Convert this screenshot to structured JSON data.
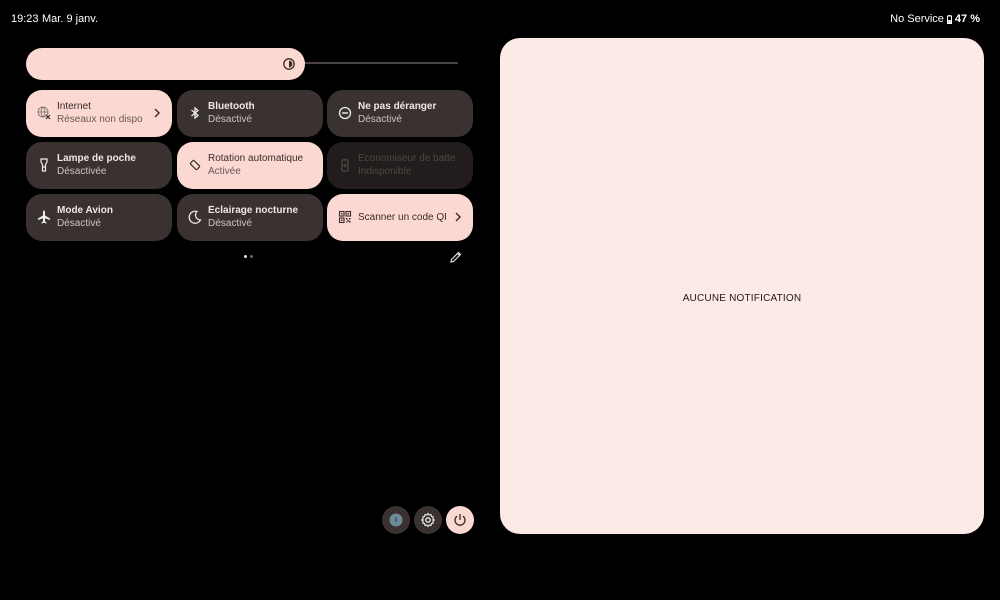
{
  "status_bar": {
    "time": "19:23",
    "date": "Mar. 9 janv.",
    "network": "No Service",
    "battery": "47 %"
  },
  "brightness": {
    "level": 0.63,
    "icon": "brightness-icon"
  },
  "tiles": [
    {
      "title": "Internet",
      "subtitle": "Réseaux non disponibles",
      "state": "active",
      "icon": "internet-off-icon"
    },
    {
      "title": "Bluetooth",
      "subtitle": "Désactivé",
      "state": "off",
      "icon": "bluetooth-icon"
    },
    {
      "title": "Ne pas déranger",
      "subtitle": "Désactivé",
      "state": "off",
      "icon": "do-not-disturb-icon"
    },
    {
      "title": "Lampe de poche",
      "subtitle": "Désactivée",
      "state": "off",
      "icon": "flashlight-icon"
    },
    {
      "title": "Rotation automatique",
      "subtitle": "Activée",
      "state": "active",
      "icon": "rotation-icon"
    },
    {
      "title": "Économiseur de batterie",
      "subtitle": "Indisponible",
      "state": "unavailable",
      "icon": "battery-saver-icon"
    },
    {
      "title": "Mode Avion",
      "subtitle": "Désactivé",
      "state": "off",
      "icon": "airplane-icon"
    },
    {
      "title": "Éclairage nocturne",
      "subtitle": "Désactivé",
      "state": "off",
      "icon": "night-light-icon"
    },
    {
      "title": "Scanner un code QR",
      "state": "active",
      "icon": "qr-code-icon"
    }
  ],
  "pagination": {
    "current_page": 1,
    "total_pages": 2
  },
  "notifications": {
    "empty_label": "AUCUNE NOTIFICATION"
  },
  "colors": {
    "accent": "#fcd8d2",
    "tile_dark": "#3a3230",
    "panel_bg": "#fceae7"
  }
}
